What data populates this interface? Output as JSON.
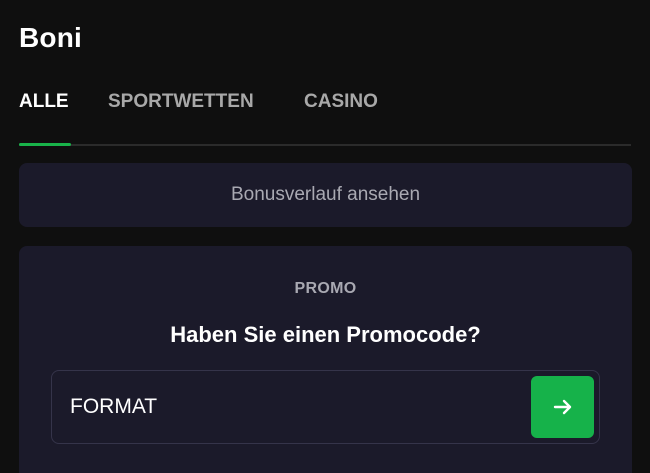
{
  "header": {
    "title": "Boni"
  },
  "tabs": [
    {
      "label": "ALLE",
      "active": true
    },
    {
      "label": "SPORTWETTEN",
      "active": false
    },
    {
      "label": "CASINO",
      "active": false
    }
  ],
  "history": {
    "label": "Bonusverlauf ansehen"
  },
  "promo": {
    "label": "PROMO",
    "question": "Haben Sie einen Promocode?",
    "input_value": "FORMAT",
    "submit_icon": "arrow-right-icon"
  },
  "colors": {
    "accent": "#16b24a",
    "background": "#0f0f0f",
    "card": "#1b1a2a",
    "muted_text": "#a9a9b2"
  }
}
